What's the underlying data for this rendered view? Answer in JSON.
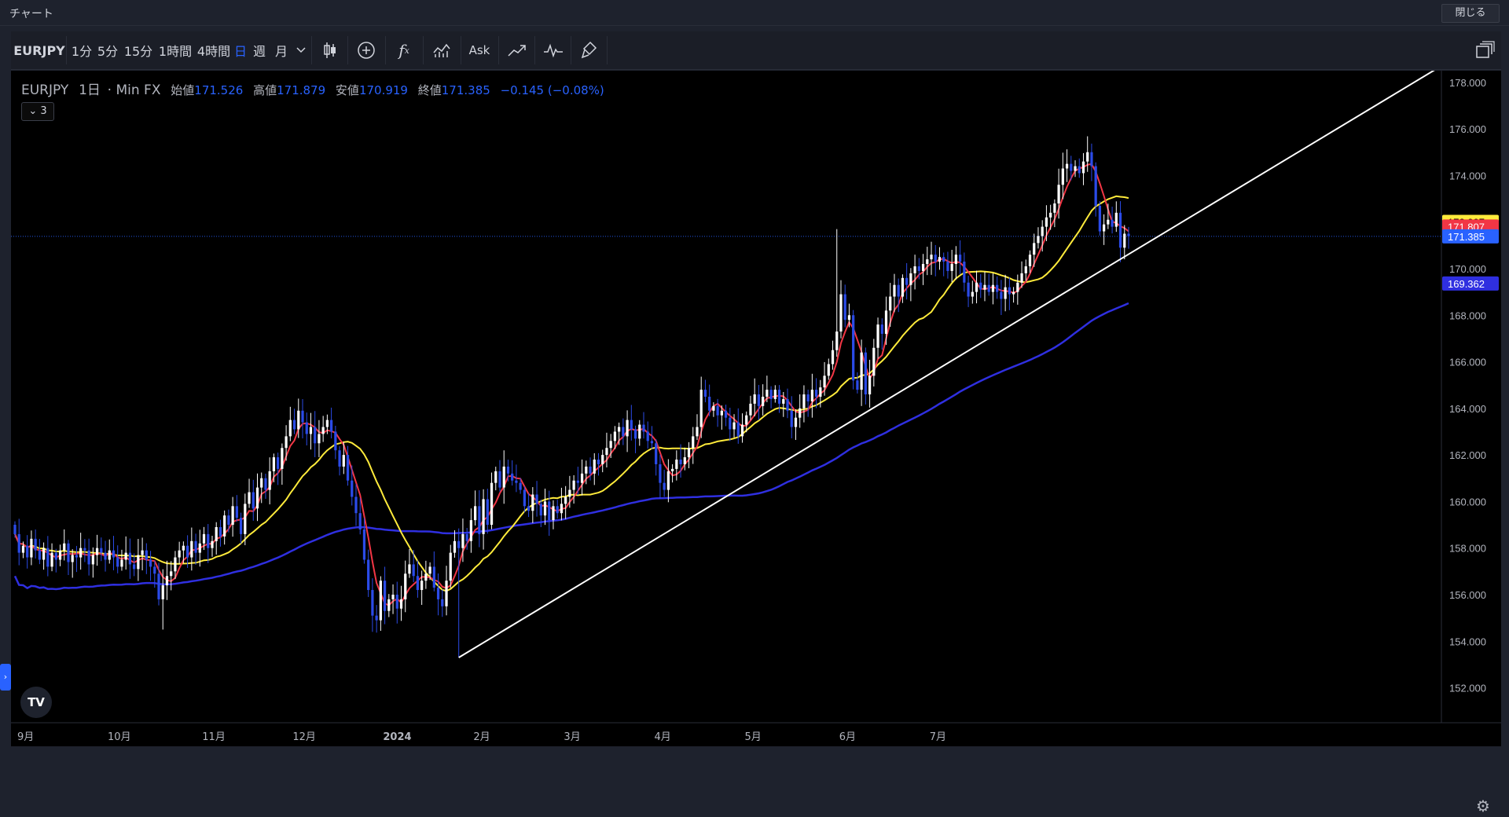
{
  "window": {
    "title": "チャート",
    "close_label": "閉じる"
  },
  "toolbar": {
    "symbol": "EURJPY",
    "intervals": [
      "1分",
      "5分",
      "15分",
      "1時間",
      "4時間",
      "日",
      "週",
      "月"
    ],
    "active_interval": "日",
    "interval_dropdown_icon": "chevron-down-icon",
    "tools": [
      "candle-type-icon",
      "add-compare-icon",
      "indicators-icon",
      "templates-icon"
    ],
    "ask_label": "Ask",
    "tools2": [
      "trend-line-icon",
      "pulse-icon",
      "brush-icon"
    ],
    "layout_icon": "layout-windows-icon"
  },
  "legend": {
    "symbol": "EURJPY",
    "interval": "1日",
    "source": "· Min FX",
    "open_label": "始値",
    "open": "171.526",
    "high_label": "高値",
    "high": "171.879",
    "low_label": "安値",
    "low": "170.919",
    "close_label": "終値",
    "close": "171.385",
    "change": "−0.145 (−0.08%)",
    "collapse_label": "3"
  },
  "colors": {
    "up_candle": "#ffffff",
    "down_candle": "#2b4be8",
    "ma_fast": "#f23645",
    "ma_mid": "#ffeb3b",
    "ma_slow": "#2f2fe0",
    "trendline": "#ffffff",
    "accent": "#2962ff"
  },
  "price_badges": [
    {
      "value": "172.007",
      "color": "#ffeb3b",
      "text_color": "#000000"
    },
    {
      "value": "171.807",
      "color": "#f23645",
      "text_color": "#ffffff"
    },
    {
      "value": "171.385",
      "color": "#2962ff",
      "text_color": "#ffffff"
    },
    {
      "value": "169.362",
      "color": "#2f2fe0",
      "text_color": "#ffffff"
    }
  ],
  "chart_data": {
    "type": "candlestick",
    "symbol": "EURJPY",
    "ylim": [
      150.5,
      178.5
    ],
    "yticks": [
      "178.000",
      "176.000",
      "174.000",
      "172.000",
      "170.000",
      "168.000",
      "166.000",
      "164.000",
      "162.000",
      "160.000",
      "158.000",
      "156.000",
      "154.000",
      "152.000"
    ],
    "xticks": [
      "9月",
      "10月",
      "11月",
      "12月",
      "2024",
      "2月",
      "3月",
      "4月",
      "5月",
      "6月",
      "7月"
    ],
    "current_price": 171.385,
    "close": [
      158.6,
      157.8,
      158.1,
      157.6,
      158.4,
      157.9,
      157.5,
      158.0,
      157.2,
      157.8,
      157.5,
      157.9,
      158.2,
      157.4,
      157.7,
      157.6,
      158.0,
      157.9,
      157.3,
      157.7,
      158.0,
      157.8,
      157.5,
      157.9,
      157.6,
      157.2,
      157.5,
      157.8,
      157.3,
      157.1,
      157.7,
      157.9,
      157.5,
      157.2,
      156.9,
      155.8,
      156.4,
      156.8,
      157.0,
      157.6,
      157.9,
      158.1,
      157.6,
      158.3,
      157.8,
      158.2,
      158.6,
      158.0,
      158.3,
      158.9,
      158.5,
      159.4,
      159.0,
      159.8,
      159.3,
      158.6,
      159.9,
      160.4,
      159.7,
      160.6,
      161.0,
      160.5,
      161.3,
      161.9,
      161.4,
      162.3,
      162.8,
      163.5,
      163.1,
      163.9,
      163.4,
      162.9,
      163.2,
      162.5,
      162.9,
      163.2,
      163.5,
      163.0,
      162.2,
      161.5,
      162.0,
      160.9,
      160.2,
      159.5,
      158.8,
      157.5,
      156.2,
      155.1,
      154.9,
      156.6,
      155.3,
      155.8,
      156.0,
      155.4,
      155.8,
      156.9,
      157.3,
      156.8,
      156.2,
      156.6,
      156.9,
      157.2,
      156.3,
      155.8,
      155.5,
      156.6,
      157.8,
      158.3,
      158.0,
      158.6,
      158.3,
      159.2,
      159.8,
      158.6,
      160.1,
      159.0,
      160.8,
      161.3,
      160.6,
      161.5,
      161.2,
      160.9,
      160.8,
      160.5,
      159.8,
      159.6,
      160.3,
      159.9,
      159.4,
      160.0,
      159.2,
      159.8,
      159.5,
      159.9,
      160.2,
      160.5,
      160.9,
      160.8,
      161.2,
      161.5,
      161.2,
      161.8,
      161.6,
      162.0,
      162.3,
      162.6,
      163.0,
      163.2,
      162.8,
      163.5,
      163.1,
      162.7,
      163.3,
      163.0,
      162.6,
      162.5,
      161.6,
      160.8,
      160.5,
      161.3,
      161.4,
      161.8,
      161.6,
      161.9,
      162.3,
      162.8,
      163.2,
      164.8,
      164.5,
      163.9,
      164.1,
      163.7,
      163.9,
      163.6,
      163.1,
      163.4,
      162.8,
      163.3,
      163.7,
      164.2,
      164.6,
      164.1,
      164.5,
      164.8,
      164.4,
      164.8,
      164.2,
      164.4,
      163.9,
      163.2,
      163.6,
      164.0,
      164.6,
      164.3,
      164.8,
      164.5,
      164.9,
      165.4,
      165.9,
      166.5,
      167.3,
      168.9,
      167.8,
      168.0,
      165.2,
      164.8,
      166.4,
      164.6,
      165.4,
      166.6,
      167.6,
      167.2,
      168.2,
      168.8,
      169.3,
      168.8,
      169.6,
      169.3,
      169.8,
      170.1,
      169.9,
      170.2,
      170.4,
      170.6,
      170.3,
      170.5,
      170.3,
      169.9,
      170.2,
      170.6,
      170.3,
      169.4,
      168.8,
      169.0,
      169.4,
      169.1,
      169.3,
      169.0,
      169.3,
      169.0,
      168.7,
      169.2,
      168.9,
      169.0,
      169.4,
      169.8,
      170.1,
      170.6,
      171.1,
      171.4,
      171.8,
      172.2,
      172.4,
      172.8,
      173.6,
      174.3,
      174.5,
      174.2,
      174.4,
      174.1,
      174.6,
      175.0,
      174.4,
      172.7,
      171.6,
      171.9,
      172.1,
      171.8,
      172.4,
      170.9,
      171.5,
      171.4
    ],
    "series": [
      {
        "kind": "ma_fast",
        "window": 5
      },
      {
        "kind": "ma_mid",
        "window": 20
      },
      {
        "kind": "ma_slow",
        "window": 100
      }
    ],
    "trendline": {
      "from": {
        "index": 108,
        "price": 153.3
      },
      "to": {
        "index": 268,
        "price": 170.3
      }
    }
  }
}
